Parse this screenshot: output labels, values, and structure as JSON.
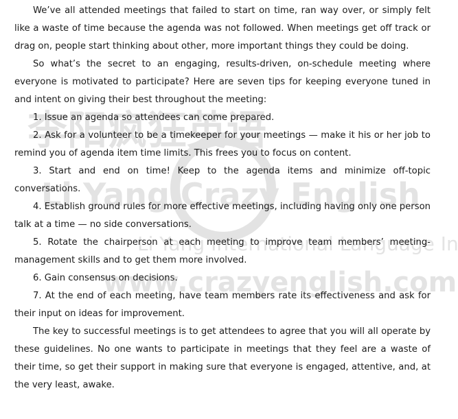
{
  "watermark": {
    "brand_cn": "李阳疯狂英语",
    "brand_en": "Li Yang Crazy English",
    "institute": "Li Yang International Language Institute",
    "website": "www.crazyenglish.com"
  },
  "article": {
    "paragraphs": [
      "We’ve all attended meetings that failed to start on time, ran way over, or simply felt like a waste of time because the agenda was not followed. When meetings get off track or drag on, people start thinking about other, more important things they could be doing.",
      "So what’s the secret to an engaging, results-driven, on-schedule meeting where everyone is motivated to participate? Here are seven tips for keeping everyone tuned in and intent on giving their best throughout the meeting:",
      "1. Issue an agenda so attendees can come prepared.",
      "2. Ask for a volunteer to be a timekeeper for your meetings — make it his or her job to remind you of agenda item time limits. This frees you to focus on content.",
      "3. Start and end on time! Keep to the agenda items and minimize off-topic conversations.",
      "4. Establish ground rules for more effective meetings, including having only one person talk at a time — no side conversations.",
      "5. Rotate the chairperson at each meeting to improve team members’ meeting-management skills and to get them more involved.",
      "6. Gain consensus on decisions.",
      "7. At the end of each meeting, have team members rate its effectiveness and ask for their input on ideas for improvement.",
      "The key to successful meetings is to get attendees to agree that you will all operate by these guidelines. No one wants to participate in meetings that they feel are a waste of their time, so get their support in making sure that everyone is engaged, attentive, and, at the very least, awake."
    ]
  }
}
